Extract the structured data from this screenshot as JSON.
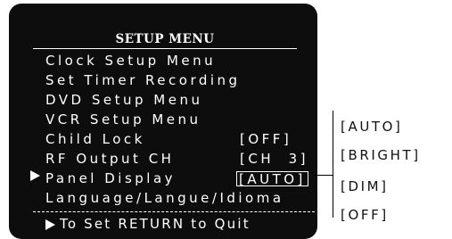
{
  "osd": {
    "title": "SETUP MENU",
    "items": [
      {
        "label": "Clock Setup Menu",
        "value": ""
      },
      {
        "label": "Set Timer Recording",
        "value": ""
      },
      {
        "label": "DVD Setup Menu",
        "value": ""
      },
      {
        "label": "VCR Setup Menu",
        "value": ""
      },
      {
        "label": "Child Lock",
        "value": "[OFF]"
      },
      {
        "label": "RF Output CH",
        "value": "[CH  3]"
      },
      {
        "label": "Panel Display",
        "value": "[AUTO]"
      },
      {
        "label": "Language/Langue/Idioma",
        "value": ""
      }
    ],
    "selected_item": "Panel Display",
    "hint": "To Set RETURN to Quit",
    "colors": {
      "background": "#0d0d0d",
      "text": "#ffffff"
    }
  },
  "panel_display_options": [
    "[AUTO]",
    "[BRIGHT]",
    "[DIM]",
    "[OFF]"
  ],
  "icons": {
    "cursor": "right-triangle-icon",
    "hint": "right-triangle-icon"
  }
}
